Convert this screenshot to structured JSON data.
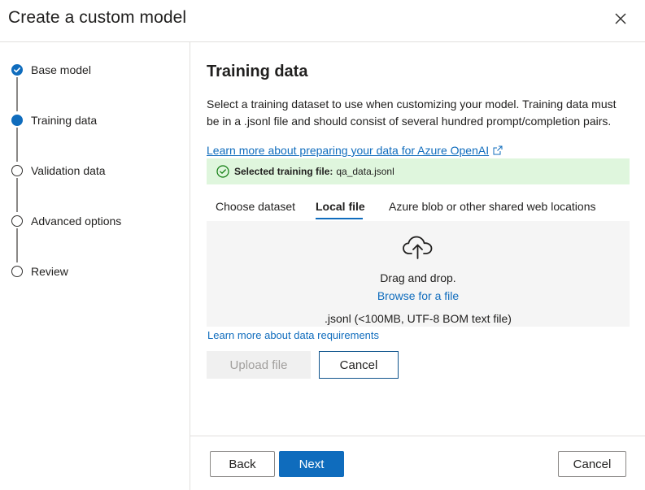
{
  "dialog": {
    "title": "Create a custom model",
    "close_icon": "close-icon"
  },
  "steps": [
    {
      "label": "Base model",
      "state": "complete",
      "icon": "check-circle-icon"
    },
    {
      "label": "Training data",
      "state": "current",
      "icon": "filled-circle-icon"
    },
    {
      "label": "Validation data",
      "state": "pending",
      "icon": "empty-circle-icon"
    },
    {
      "label": "Advanced options",
      "state": "pending",
      "icon": "empty-circle-icon"
    },
    {
      "label": "Review",
      "state": "pending",
      "icon": "empty-circle-icon"
    }
  ],
  "main": {
    "title": "Training data",
    "description": "Select a training dataset to use when customizing your model. Training data must be in a .jsonl file and should consist of several hundred prompt/completion pairs.",
    "learn_more_link": "Learn more about preparing your data for Azure OpenAI",
    "external_link_icon": "external-link-icon",
    "success": {
      "icon": "check-circle-icon",
      "label": "Selected training file:",
      "value": "qa_data.jsonl"
    },
    "tabs": [
      {
        "label": "Choose dataset",
        "active": false
      },
      {
        "label": "Local file",
        "active": true
      },
      {
        "label": "Azure blob or other shared web locations",
        "active": false
      }
    ],
    "dropzone": {
      "icon": "cloud-upload-icon",
      "line1": "Drag and drop.",
      "browse": "Browse for a file",
      "hint": ".jsonl (<100MB, UTF-8 BOM text file)"
    },
    "requirements_link": "Learn more about data requirements",
    "upload_button": "Upload file",
    "cancel_button": "Cancel"
  },
  "footer": {
    "back": "Back",
    "next": "Next",
    "cancel": "Cancel"
  },
  "colors": {
    "accent": "#0f6cbd",
    "success_bg": "#dff6dd",
    "success_icon": "#107c10",
    "dropzone_bg": "#f5f5f5"
  }
}
